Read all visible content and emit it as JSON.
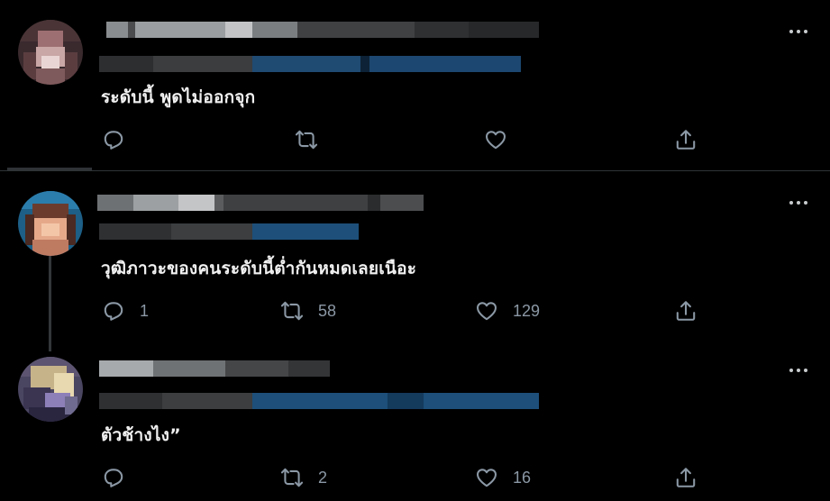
{
  "tweets": [
    {
      "text": "ระดับนี้ พูดไม่ออกจุก",
      "reply_count": "",
      "retweet_count": "",
      "like_count": ""
    },
    {
      "text": "วุฒิภาวะของคนระดับนี้ต่ำกันหมดเลยเนือะ",
      "reply_count": "1",
      "retweet_count": "58",
      "like_count": "129"
    },
    {
      "text": "ตัวช้างไง”",
      "reply_count": "",
      "retweet_count": "2",
      "like_count": "16"
    }
  ],
  "colors": {
    "background": "#000000",
    "text": "#e7e9ea",
    "muted": "#8b98a5",
    "divider": "#2f3336",
    "mention_blue": "#1d4f7a"
  },
  "icons": [
    "more-icon",
    "reply-icon",
    "retweet-icon",
    "like-icon",
    "share-icon"
  ]
}
